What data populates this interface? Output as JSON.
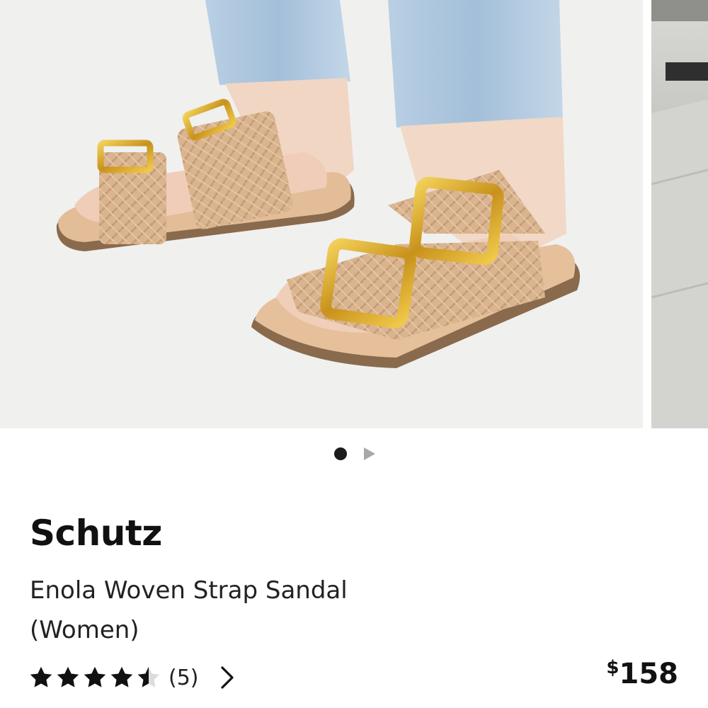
{
  "product": {
    "brand": "Schutz",
    "name": "Enola Woven Strap Sandal (Women)",
    "rating": 4.5,
    "rating_count": "(5)",
    "price_currency": "$",
    "price_amount": "158"
  },
  "carousel": {
    "active_index": 0,
    "total": 2
  },
  "colors": {
    "sandal": "#d9b48e",
    "buckle": "#d7a628",
    "denim": "#a9c3dc"
  }
}
